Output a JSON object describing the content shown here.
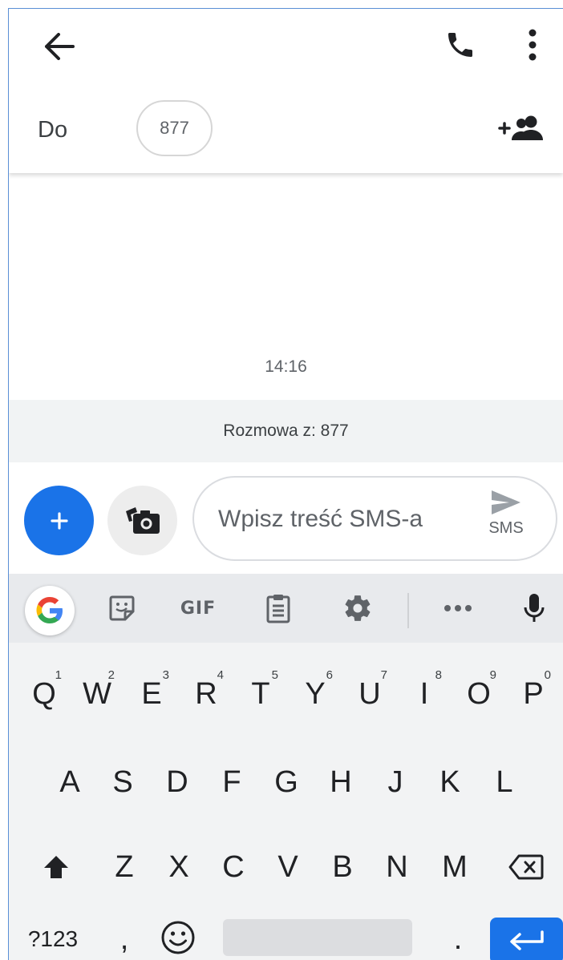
{
  "header": {
    "to_label": "Do",
    "recipient_chip": "877"
  },
  "conversation": {
    "timestamp": "14:16",
    "banner": "Rozmowa z: 877"
  },
  "compose": {
    "placeholder": "Wpisz treść SMS-a",
    "send_label": "SMS"
  },
  "keyboard": {
    "toolbar": {
      "gif_label": "GIF"
    },
    "row1": [
      {
        "key": "Q",
        "hint": "1"
      },
      {
        "key": "W",
        "hint": "2"
      },
      {
        "key": "E",
        "hint": "3"
      },
      {
        "key": "R",
        "hint": "4"
      },
      {
        "key": "T",
        "hint": "5"
      },
      {
        "key": "Y",
        "hint": "6"
      },
      {
        "key": "U",
        "hint": "7"
      },
      {
        "key": "I",
        "hint": "8"
      },
      {
        "key": "O",
        "hint": "9"
      },
      {
        "key": "P",
        "hint": "0"
      }
    ],
    "row2": [
      "A",
      "S",
      "D",
      "F",
      "G",
      "H",
      "J",
      "K",
      "L"
    ],
    "row3": [
      "Z",
      "X",
      "C",
      "V",
      "B",
      "N",
      "M"
    ],
    "row4": {
      "symbols": "?123",
      "comma": ",",
      "period": "."
    }
  },
  "colors": {
    "accent": "#1a73e8",
    "keyboard_bg": "#f2f3f4",
    "toolbar_bg": "#e8eaed"
  }
}
